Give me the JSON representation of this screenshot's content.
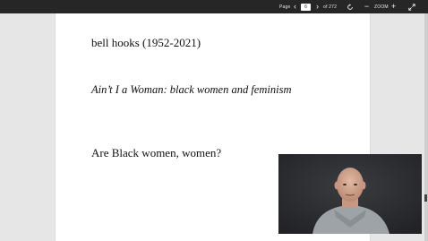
{
  "toolbar": {
    "page_label": "Page",
    "current_page": "6",
    "total_pages": "of 272",
    "zoom_label": "ZOOM",
    "icons": [
      "chevron-left-icon",
      "chevron-right-icon",
      "rotate-icon",
      "minus-icon",
      "plus-icon",
      "expand-icon"
    ]
  },
  "document": {
    "line1": "bell hooks (1952-2021)",
    "line2": "Ain’t I a Woman: black women and feminism",
    "line3": "Are Black women, women?"
  },
  "colors": {
    "toolbar_bg": "#262626",
    "viewer_bg": "#e6e6e6",
    "page_bg": "#ffffff"
  }
}
